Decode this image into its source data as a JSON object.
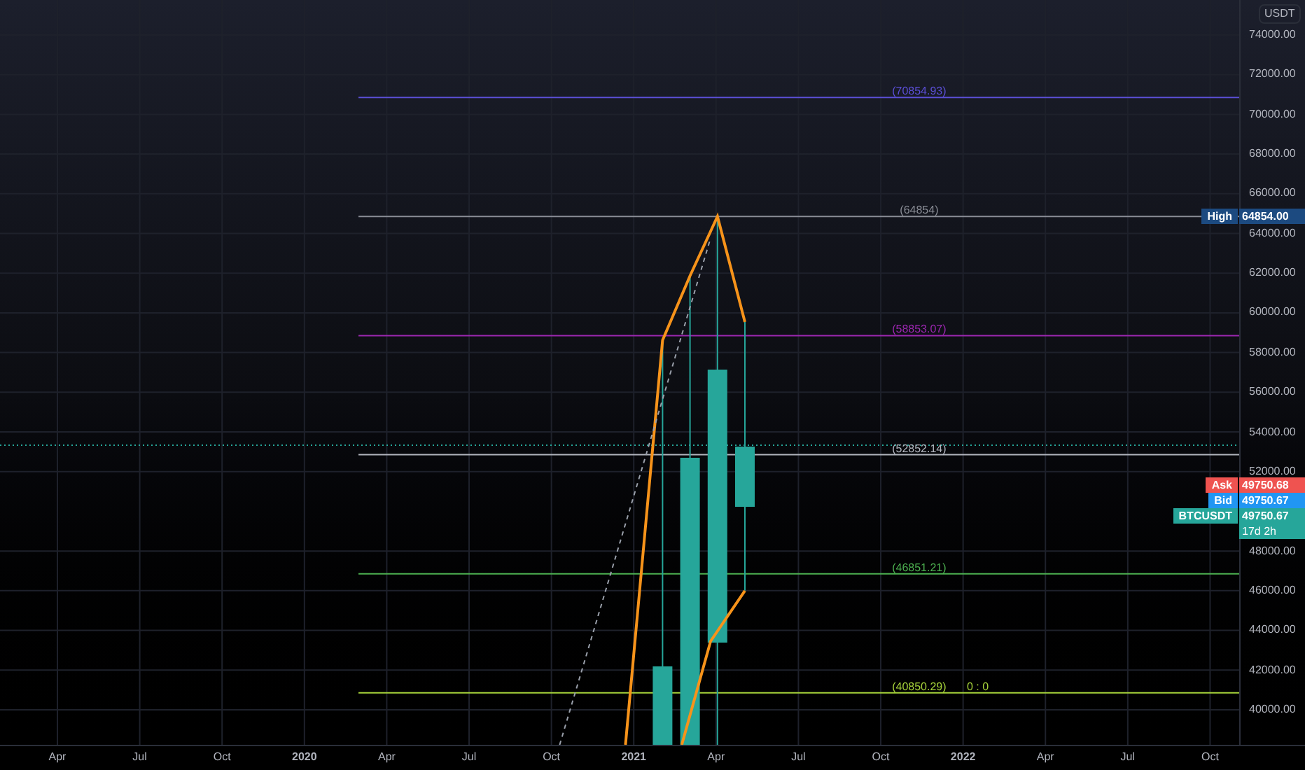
{
  "currency_button": "USDT",
  "price_axis": [
    "74000.00",
    "72000.00",
    "70000.00",
    "68000.00",
    "66000.00",
    "64000.00",
    "62000.00",
    "60000.00",
    "58000.00",
    "56000.00",
    "54000.00",
    "52000.00",
    "48000.00",
    "46000.00",
    "44000.00",
    "42000.00",
    "40000.00"
  ],
  "time_axis": [
    {
      "label": "Apr",
      "kind": "month"
    },
    {
      "label": "Jul",
      "kind": "month"
    },
    {
      "label": "Oct",
      "kind": "month"
    },
    {
      "label": "2020",
      "kind": "year"
    },
    {
      "label": "Apr",
      "kind": "month"
    },
    {
      "label": "Jul",
      "kind": "month"
    },
    {
      "label": "Oct",
      "kind": "month"
    },
    {
      "label": "2021",
      "kind": "year"
    },
    {
      "label": "Apr",
      "kind": "month"
    },
    {
      "label": "Jul",
      "kind": "month"
    },
    {
      "label": "Oct",
      "kind": "month"
    },
    {
      "label": "2022",
      "kind": "year"
    },
    {
      "label": "Apr",
      "kind": "month"
    },
    {
      "label": "Jul",
      "kind": "month"
    },
    {
      "label": "Oct",
      "kind": "month"
    }
  ],
  "levels": [
    {
      "label": "(70854.93)",
      "color": "#5b4fd6"
    },
    {
      "label": "(64854)",
      "color": "#8a8d96"
    },
    {
      "label": "(58853.07)",
      "color": "#9c27b0"
    },
    {
      "label": "(52852.14)",
      "color": "#b2b5be"
    },
    {
      "label": "(46851.21)",
      "color": "#4caf50"
    },
    {
      "label": "(40850.29)",
      "color": "#a5d13a",
      "extra": "0 : 0"
    }
  ],
  "price_tags": [
    {
      "kind": "high",
      "label": "High",
      "value": "64854.00",
      "color": "#1c4a80"
    },
    {
      "kind": "stack",
      "label": "Ask",
      "value": "49750.68",
      "color": "#ef5350"
    },
    {
      "kind": "stack",
      "label": "Bid",
      "value": "49750.67",
      "color": "#2196f3"
    },
    {
      "kind": "stack",
      "label": "BTCUSDT",
      "value": "49750.67",
      "countdown": "17d 2h",
      "color": "#26a69a"
    }
  ]
}
